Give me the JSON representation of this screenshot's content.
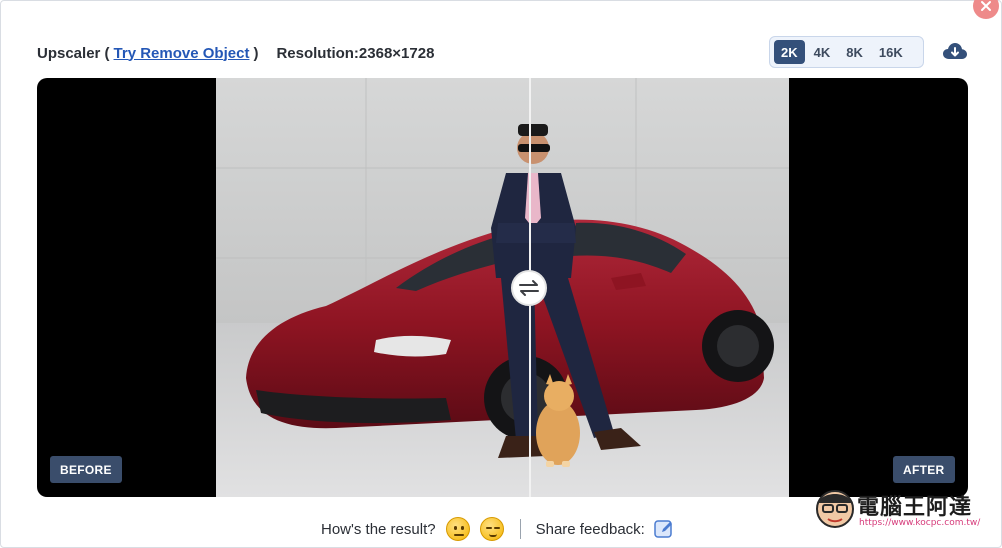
{
  "header": {
    "tool_name": "Upscaler (",
    "link_text": "Try Remove Object",
    "paren_close": ")",
    "resolution": "Resolution:2368×1728"
  },
  "resolution_tabs": [
    {
      "label": "2K",
      "active": true
    },
    {
      "label": "4K",
      "active": false
    },
    {
      "label": "8K",
      "active": false
    },
    {
      "label": "16K",
      "active": false
    }
  ],
  "icons": {
    "close": "close-icon",
    "download": "cloud-download-icon",
    "compare_handle": "swap-arrows-icon",
    "feedback": "edit-icon"
  },
  "viewer": {
    "before_label": "BEFORE",
    "after_label": "AFTER"
  },
  "footer": {
    "question": "How's the result?",
    "share_label": "Share feedback:"
  },
  "watermark": {
    "title": "電腦王阿達",
    "url": "https://www.kocpc.com.tw/"
  },
  "colors": {
    "accent": "#34507a",
    "link": "#2457b6",
    "close": "#ee8a8a",
    "car": "#8e1422"
  }
}
